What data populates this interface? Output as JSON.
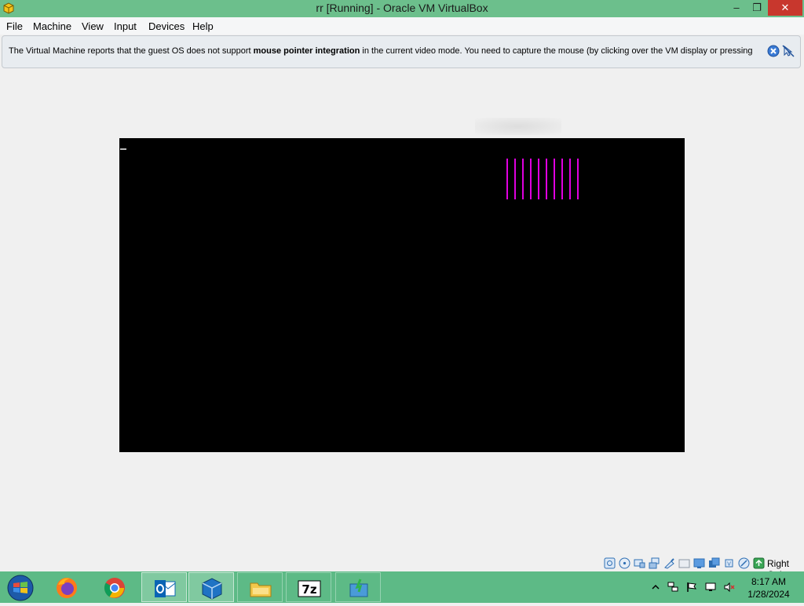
{
  "window": {
    "title": "rr [Running] - Oracle VM VirtualBox",
    "minimize_glyph": "–",
    "restore_glyph": "❐",
    "close_glyph": "✕"
  },
  "menu": {
    "items": [
      "File",
      "Machine",
      "View",
      "Input",
      "Devices",
      "Help"
    ]
  },
  "notice": {
    "text_before": "The Virtual Machine reports that the guest OS does not support ",
    "text_bold": "mouse pointer integration",
    "text_after": " in the current video mode. You need to capture the mouse (by clicking over the VM display or pressing",
    "icons": [
      "close-message-icon",
      "mouse-integration-off-icon"
    ]
  },
  "vm_display": {
    "background": "#000000",
    "bar_color": "#e000e0",
    "bar_count": 10
  },
  "statusbar": {
    "icons": [
      "hard-disk-icon",
      "optical-drive-icon",
      "audio-icon",
      "network-icon",
      "usb-icon",
      "shared-folders-icon",
      "display-icon",
      "video-capture-icon",
      "cpu-icon",
      "mouse-integration-icon",
      "host-key-icon"
    ],
    "host_key": "Right Ctrl"
  },
  "taskbar": {
    "apps": [
      {
        "name": "firefox",
        "icon": "firefox-icon"
      },
      {
        "name": "chrome",
        "icon": "chrome-icon"
      },
      {
        "name": "outlook",
        "icon": "outlook-icon"
      },
      {
        "name": "virtualbox",
        "icon": "virtualbox-icon"
      },
      {
        "name": "file-explorer",
        "icon": "folder-icon"
      },
      {
        "name": "7-zip",
        "icon": "7zip-icon",
        "label": "7z"
      },
      {
        "name": "installer",
        "icon": "installer-icon"
      }
    ],
    "tray_icons": [
      "show-hidden-icons",
      "network-tray-icon",
      "action-center-flag-icon",
      "display-tray-icon",
      "volume-muted-icon"
    ],
    "time": "8:17 AM",
    "date": "1/28/2024"
  },
  "colors": {
    "title_bar": "#6cbf8c",
    "taskbar": "#5dba86",
    "close_button": "#c8372d"
  }
}
